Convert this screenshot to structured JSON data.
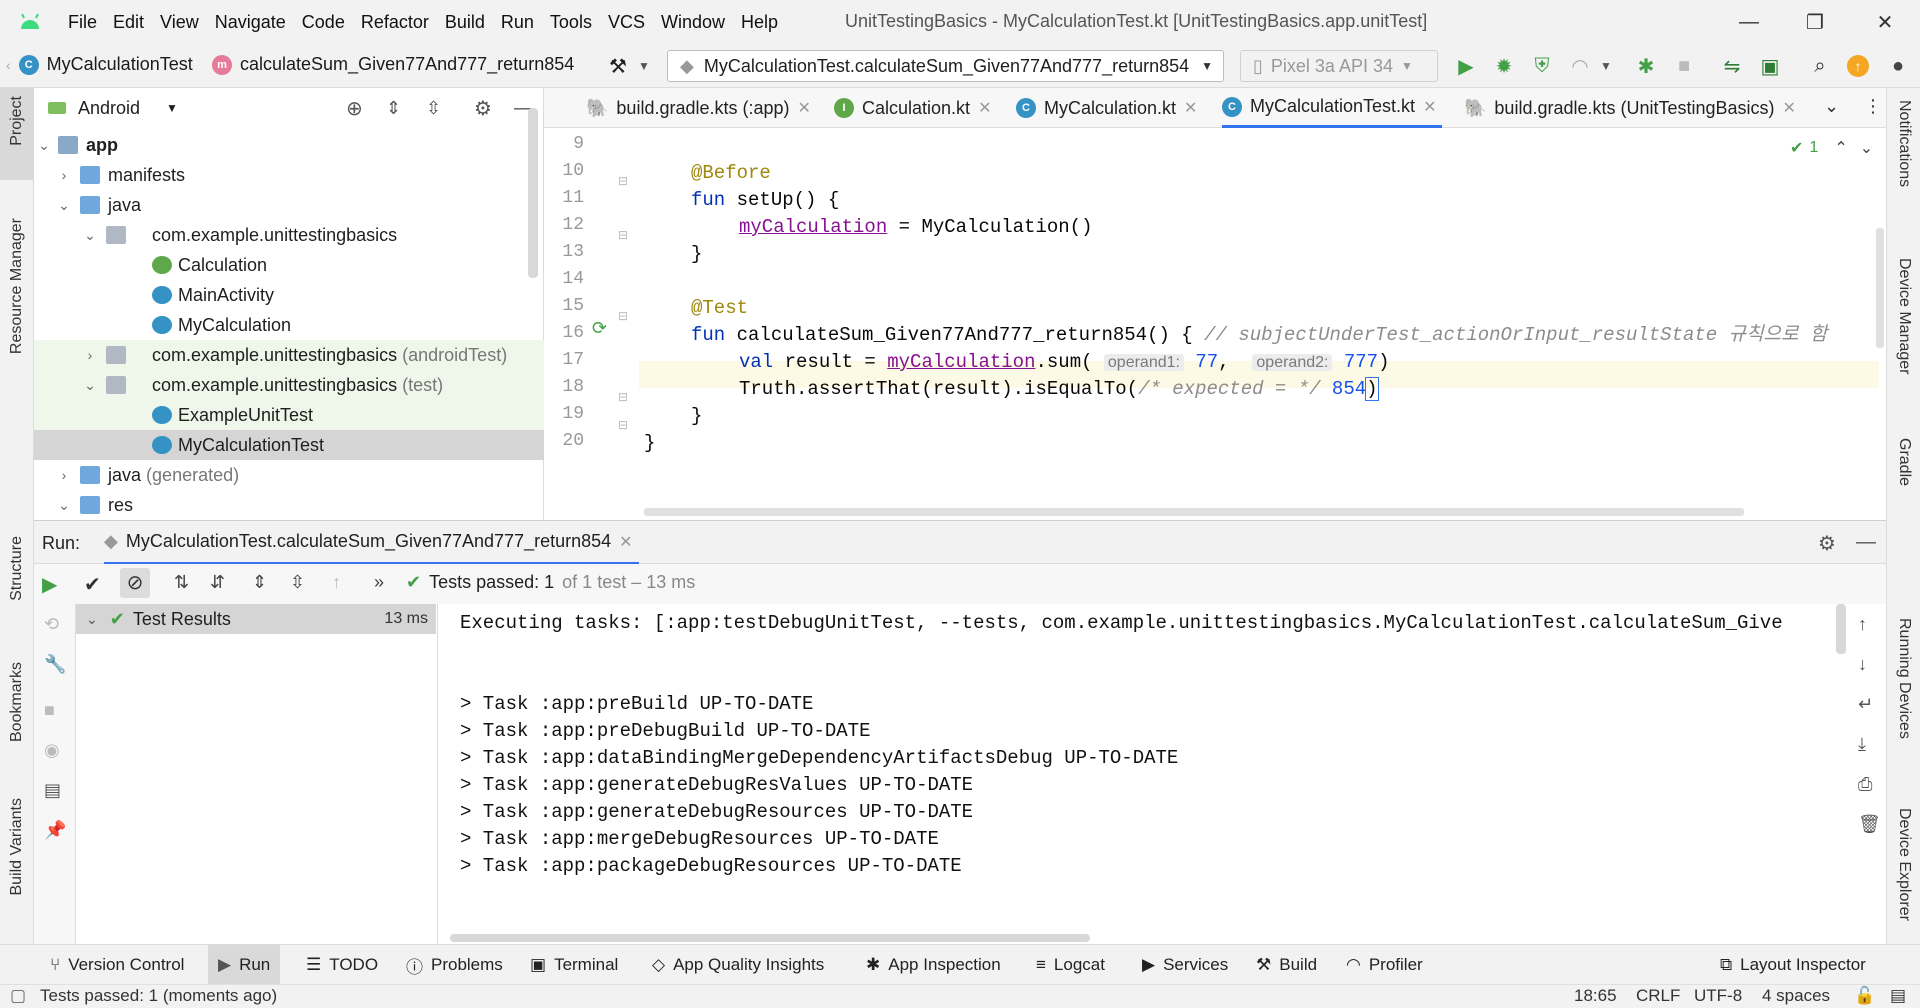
{
  "menubar": {
    "items": [
      "File",
      "Edit",
      "View",
      "Navigate",
      "Code",
      "Refactor",
      "Build",
      "Run",
      "Tools",
      "VCS",
      "Window",
      "Help"
    ],
    "window_title": "UnitTestingBasics - MyCalculationTest.kt [UnitTestingBasics.app.unitTest]"
  },
  "navbar": {
    "crumb_class": "MyCalculationTest",
    "crumb_method": "calculateSum_Given77And777_return854",
    "run_config": "MyCalculationTest.calculateSum_Given77And777_return854",
    "device": "Pixel 3a API 34"
  },
  "left_strip": {
    "project": "Project",
    "resource_manager": "Resource Manager",
    "structure": "Structure",
    "bookmarks": "Bookmarks",
    "build_variants": "Build Variants"
  },
  "right_strip": {
    "notifications": "Notifications",
    "device_manager": "Device Manager",
    "gradle": "Gradle",
    "running_devices": "Running Devices",
    "device_explorer": "Device Explorer"
  },
  "project": {
    "view_mode": "Android",
    "tree": [
      {
        "label": "app",
        "suffix": ""
      },
      {
        "label": "manifests",
        "suffix": ""
      },
      {
        "label": "java",
        "suffix": ""
      },
      {
        "label": "com.example.unittestingbasics",
        "suffix": ""
      },
      {
        "label": "Calculation",
        "suffix": ""
      },
      {
        "label": "MainActivity",
        "suffix": ""
      },
      {
        "label": "MyCalculation",
        "suffix": ""
      },
      {
        "label": "com.example.unittestingbasics",
        "suffix": "(androidTest)"
      },
      {
        "label": "com.example.unittestingbasics",
        "suffix": "(test)"
      },
      {
        "label": "ExampleUnitTest",
        "suffix": ""
      },
      {
        "label": "MyCalculationTest",
        "suffix": ""
      },
      {
        "label": "java",
        "suffix": "(generated)"
      },
      {
        "label": "res",
        "suffix": ""
      }
    ]
  },
  "tabs": [
    "build.gradle.kts (:app)",
    "Calculation.kt",
    "MyCalculation.kt",
    "MyCalculationTest.kt",
    "build.gradle.kts (UnitTestingBasics)"
  ],
  "editor": {
    "inspection_count": "1",
    "line_numbers": [
      "9",
      "10",
      "11",
      "12",
      "13",
      "14",
      "15",
      "16",
      "17",
      "18",
      "19",
      "20"
    ],
    "l10": "@Before",
    "l11_kw": "fun",
    "l11_fn": " setUp() {",
    "l12_prop": "myCalculation",
    "l12_rest": " = MyCalculation()",
    "l13": "}",
    "l15": "@Test",
    "l16_kw": "fun",
    "l16_fn": " calculateSum_Given77And777_return854() { ",
    "l16_cm": "// subjectUnderTest_actionOrInput_resultState 규칙으로 함",
    "l17_kw": "val",
    "l17_a": " result = ",
    "l17_prop": "myCalculation",
    "l17_b": ".sum(",
    "l17_hint1": "operand1:",
    "l17_n1": "77",
    "l17_c": ", ",
    "l17_hint2": "operand2:",
    "l17_n2": "777",
    "l17_d": ")",
    "l18_a": "Truth.assertThat(result).isEqualTo(",
    "l18_cm": "/* expected = */",
    "l18_n": "854",
    "l18_b": ")",
    "l19": "}",
    "l20": "}"
  },
  "run": {
    "label": "Run:",
    "tab": "MyCalculationTest.calculateSum_Given77And777_return854",
    "status_bold": "Tests passed: 1",
    "status_rest": "of 1 test – 13 ms",
    "tree_root": "Test Results",
    "tree_time": "13 ms",
    "console": [
      "Executing tasks: [:app:testDebugUnitTest, --tests, com.example.unittestingbasics.MyCalculationTest.calculateSum_Give",
      "",
      "",
      "> Task :app:preBuild UP-TO-DATE",
      "> Task :app:preDebugBuild UP-TO-DATE",
      "> Task :app:dataBindingMergeDependencyArtifactsDebug UP-TO-DATE",
      "> Task :app:generateDebugResValues UP-TO-DATE",
      "> Task :app:generateDebugResources UP-TO-DATE",
      "> Task :app:mergeDebugResources UP-TO-DATE",
      "> Task :app:packageDebugResources UP-TO-DATE"
    ]
  },
  "toolwindows": [
    "Version Control",
    "Run",
    "TODO",
    "Problems",
    "Terminal",
    "App Quality Insights",
    "App Inspection",
    "Logcat",
    "Services",
    "Build",
    "Profiler",
    "Layout Inspector"
  ],
  "statusbar": {
    "message": "Tests passed: 1 (moments ago)",
    "position": "18:65",
    "line_sep": "CRLF",
    "encoding": "UTF-8",
    "indent": "4 spaces"
  },
  "colors": {
    "accent": "#3574f0",
    "run_green": "#43a047",
    "kotlin": "#3592c4"
  }
}
